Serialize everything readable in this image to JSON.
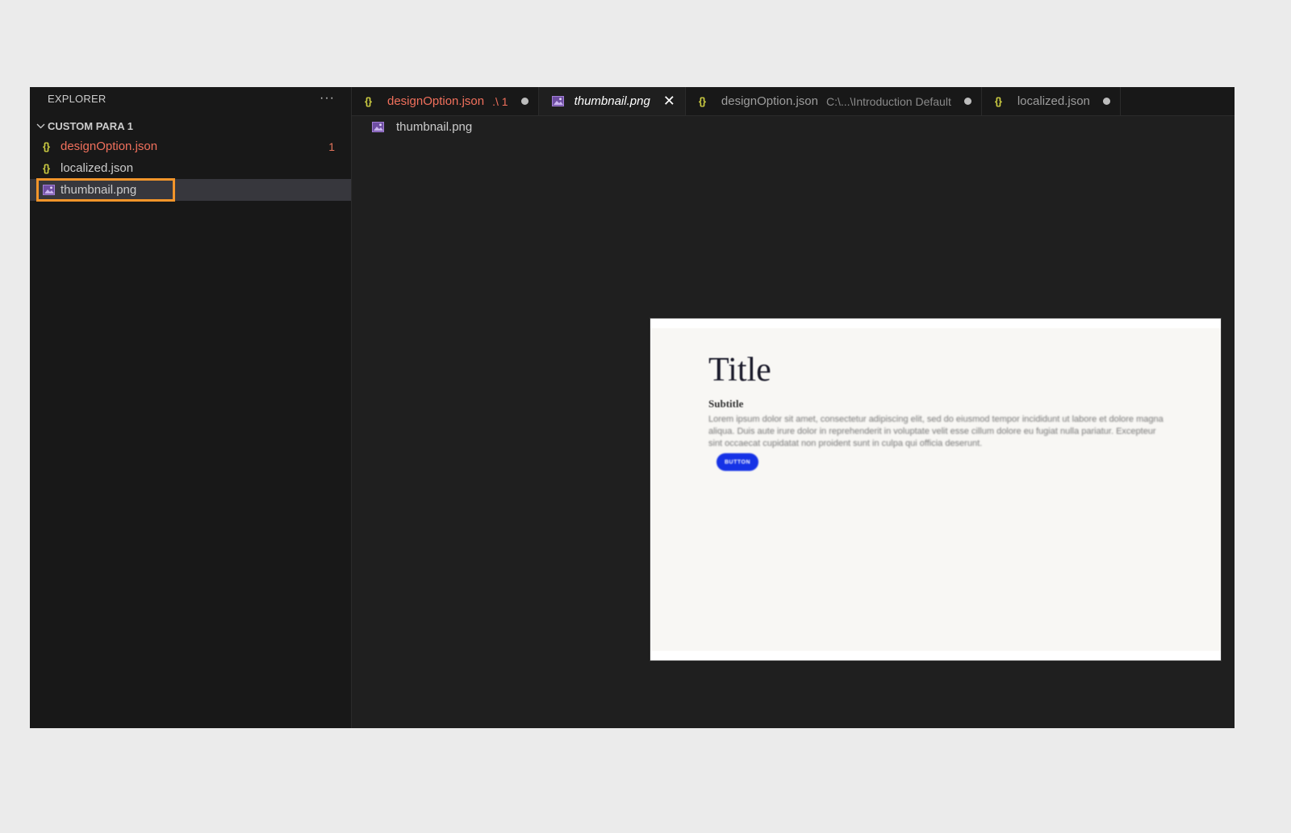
{
  "sidebar": {
    "header": "EXPLORER",
    "more_label": "···",
    "section_title": "CUSTOM PARA 1",
    "items": [
      {
        "name": "designOption.json",
        "icon": "json-icon",
        "badge": "1",
        "status": "error"
      },
      {
        "name": "localized.json",
        "icon": "json-icon"
      },
      {
        "name": "thumbnail.png",
        "icon": "image-icon",
        "selected": true
      }
    ]
  },
  "tabs": [
    {
      "label": "designOption.json",
      "suffix": ".\\ 1",
      "icon": "json-icon",
      "modified": true,
      "status": "error"
    },
    {
      "label": "thumbnail.png",
      "icon": "image-icon",
      "active": true,
      "close": "✕"
    },
    {
      "label": "designOption.json",
      "suffix": "C:\\...\\Introduction Default",
      "icon": "json-icon",
      "modified": true
    },
    {
      "label": "localized.json",
      "icon": "json-icon",
      "modified": true
    }
  ],
  "breadcrumb": {
    "file": "thumbnail.png"
  },
  "preview": {
    "title": "Title",
    "subtitle": "Subtitle",
    "body": "Lorem ipsum dolor sit amet, consectetur adipiscing elit, sed do eiusmod tempor incididunt ut labore et dolore magna aliqua. Duis aute irure dolor in reprehenderit in voluptate velit esse cillum dolore eu fugiat nulla pariatur. Excepteur sint occaecat cupidatat non proident sunt in culpa qui officia deserunt.",
    "button": "BUTTON"
  },
  "colors": {
    "highlight": "#f3952a",
    "error": "#f1705c",
    "json_icon": "#cbcb41",
    "image_icon": "#a27fd6",
    "preview_button": "#1532e6"
  }
}
